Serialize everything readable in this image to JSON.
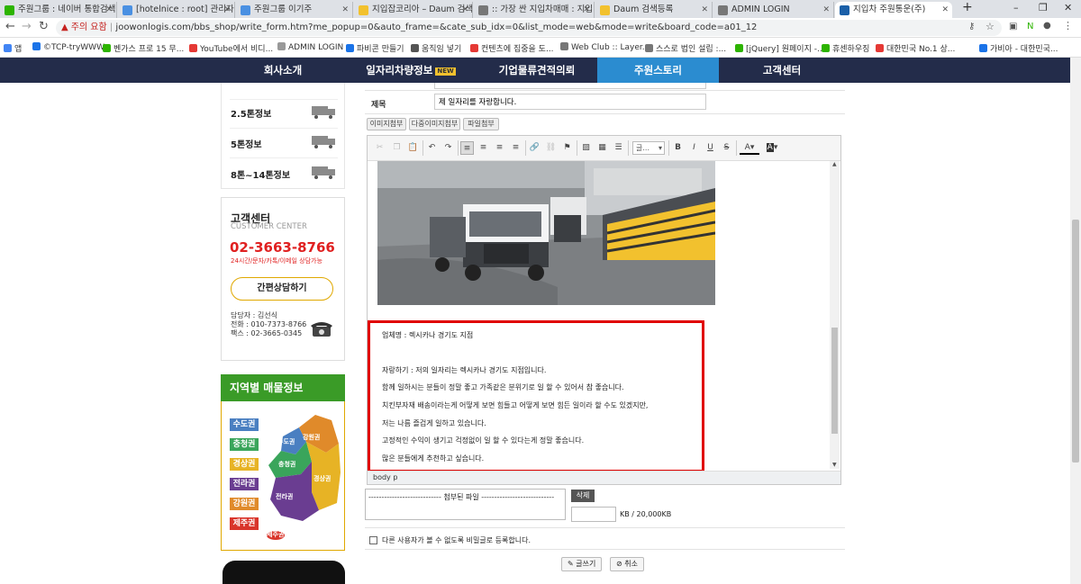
{
  "browser": {
    "tabs": [
      {
        "title": "주원그룹 : 네이버 통합검색",
        "color": "#2db400",
        "active": false
      },
      {
        "title": "[hotelnice : root] 관리자 페",
        "color": "#4a90e2",
        "active": false
      },
      {
        "title": "주원그룹 이기주",
        "color": "#4a90e2",
        "active": false
      },
      {
        "title": "지입잡코리아 – Daum 검색",
        "color": "#f2c12e",
        "active": false
      },
      {
        "title": ":: 가장 싼 지입차매매 : 지입",
        "color": "#777777",
        "active": false
      },
      {
        "title": "Daum 검색등록",
        "color": "#f2c12e",
        "active": false
      },
      {
        "title": "ADMIN LOGIN",
        "color": "#777777",
        "active": false
      },
      {
        "title": "지입차 주원통운(주)",
        "color": "#1a5fa8",
        "active": true
      }
    ],
    "new_tab": "+",
    "win_controls": [
      "–",
      "❐",
      "✕"
    ],
    "nav": {
      "back": "←",
      "forward": "→",
      "reload": "↻"
    },
    "security_label": "주의 요함",
    "url": "joowonlogis.com/bbs_shop/write_form.htm?me_popup=0&auto_frame=&cate_sub_idx=0&list_mode=web&mode=write&board_code=a01_12",
    "bookmarks": [
      {
        "label": "앱",
        "color": "#4285f4"
      },
      {
        "label": "©TCP-tryWWW",
        "color": "#1a73e8"
      },
      {
        "label": "벤가스 프로 15 무...",
        "color": "#2db400"
      },
      {
        "label": "YouTube에서 비디...",
        "color": "#e53935"
      },
      {
        "label": "ADMIN LOGIN",
        "color": "#999999"
      },
      {
        "label": "파비콘 만들기",
        "color": "#1a73e8"
      },
      {
        "label": "움직임 넣기",
        "color": "#555555"
      },
      {
        "label": "컨텐츠에 집중을 도...",
        "color": "#e53935"
      },
      {
        "label": "Web Club :: Layer...",
        "color": "#777777"
      },
      {
        "label": "스스로 법인 설립 :...",
        "color": "#777777"
      },
      {
        "label": "[jQuery] 원페이지 -...",
        "color": "#2db400"
      },
      {
        "label": "휴센하우징",
        "color": "#2db400"
      },
      {
        "label": "대한민국 No.1 상...",
        "color": "#e53935"
      },
      {
        "label": "가비아 - 대한민국...",
        "color": "#1a73e8"
      }
    ]
  },
  "site_nav": [
    {
      "label": "회사소개",
      "active": false,
      "badge": ""
    },
    {
      "label": "일자리차량정보",
      "active": false,
      "badge": "NEW"
    },
    {
      "label": "기업물류견적의뢰",
      "active": false,
      "badge": ""
    },
    {
      "label": "주원스토리",
      "active": true,
      "badge": ""
    },
    {
      "label": "고객센터",
      "active": false,
      "badge": ""
    }
  ],
  "sidebar": {
    "ton_items": [
      "2.5톤정보",
      "5톤정보",
      "8톤~14톤정보"
    ],
    "cs": {
      "title": "고객센터",
      "subtitle": "CUSTOMER CENTER",
      "phone": "02-3663-8766",
      "note": "24시간/문자/카톡/이메일 상담가능",
      "consult_button": "간편상담하기",
      "contact": [
        "담당자 : 김선식",
        "전화 : 010-7373-8766",
        "팩스 : 02-3665-0345"
      ]
    },
    "region": {
      "title": "지역별 매물정보",
      "labels": [
        {
          "name": "수도권",
          "color": "#4a7fc1"
        },
        {
          "name": "충청권",
          "color": "#3aa55b"
        },
        {
          "name": "경상권",
          "color": "#e7b325"
        },
        {
          "name": "전라권",
          "color": "#6a3d91"
        },
        {
          "name": "강원권",
          "color": "#e08a2a"
        },
        {
          "name": "제주권",
          "color": "#d9352b"
        }
      ],
      "map_labels": [
        "강원권",
        "수도권",
        "충청권",
        "경상권",
        "전라권",
        "제주권"
      ]
    }
  },
  "form": {
    "title_label": "제목",
    "title_value": "제 일자리를 자랑합니다.",
    "attach_buttons": [
      "이미지첨부",
      "다중이미지첨부",
      "파일첨부"
    ],
    "toolbar": {
      "font_select": "글...",
      "bold": "B",
      "italic": "I",
      "underline": "U",
      "strike": "S",
      "font_color": "A",
      "bg_color": "A"
    },
    "content_lines": [
      "업체명 : 렉시카나 경기도 지점",
      "자랑하기 : 저의 일자리는 렉시카나 경기도 지점입니다.",
      "함께 일하시는 분들이 정말 좋고 가족같은 분위기로 일 할 수 있어서 참 좋습니다.",
      "치킨부자재 배송이라는게 어떻게 보면 힘들고 어떻게 보면 힘든 일이라 할 수도 있겠지만,",
      "저는 나름 즐겁게 일하고 있습니다.",
      "고정적인 수익이 생기고 걱정없이 일 할 수 있다는게 정말 좋습니다.",
      "많은 분들에게 추천하고 싶습니다."
    ],
    "path": "body  p",
    "files_label": "---------------------------- 첨부된 파일 ----------------------------",
    "delete_button": "삭제",
    "kb_label": "KB / 20,000KB",
    "secret_label": "다른 사용자가 볼 수 없도록 비밀글로 등록합니다.",
    "submit_button": "글쓰기",
    "cancel_button": "취소"
  }
}
